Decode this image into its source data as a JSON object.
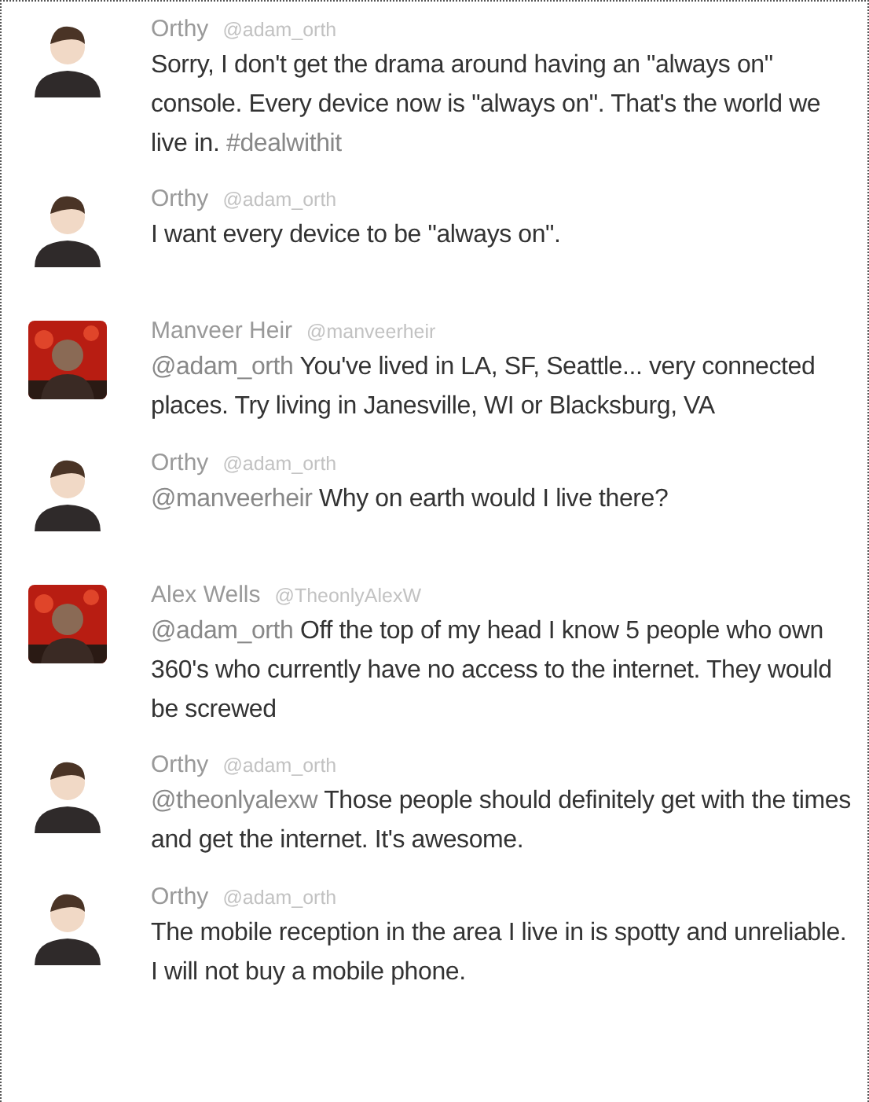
{
  "tweets": [
    {
      "name": "Orthy",
      "handle": "@adam_orth",
      "avatar": {
        "kind": "drawn"
      },
      "body": [
        {
          "kind": "text",
          "text": "Sorry, I don't get the drama around having an \"always on\" console. Every device now is \"always on\". That's the world we live in. "
        },
        {
          "kind": "link",
          "text": "#dealwithit"
        }
      ]
    },
    {
      "name": "Orthy",
      "handle": "@adam_orth",
      "avatar": {
        "kind": "drawn"
      },
      "body": [
        {
          "kind": "text",
          "text": "I want every device to be \"always on\"."
        }
      ]
    },
    {
      "name": "Manveer Heir",
      "handle": "@manveerheir",
      "body": [
        {
          "kind": "link",
          "text": "@adam_orth"
        },
        {
          "kind": "text",
          "text": " You've lived in LA, SF, Seattle... very connected places. Try living in Janesville, WI or Blacksburg, VA"
        }
      ]
    },
    {
      "name": "Orthy",
      "handle": "@adam_orth",
      "avatar": {
        "kind": "drawn"
      },
      "body": [
        {
          "kind": "link",
          "text": "@manveerheir"
        },
        {
          "kind": "text",
          "text": " Why on earth would I live there?"
        }
      ]
    },
    {
      "name": "Alex Wells",
      "handle": "@TheonlyAlexW",
      "body": [
        {
          "kind": "link",
          "text": "@adam_orth"
        },
        {
          "kind": "text",
          "text": " Off the top of my head I know 5 people who own 360's who currently have no access to the internet. They would be screwed"
        }
      ]
    },
    {
      "name": "Orthy",
      "handle": "@adam_orth",
      "avatar": {
        "kind": "drawn"
      },
      "body": [
        {
          "kind": "link",
          "text": "@theonlyalexw"
        },
        {
          "kind": "text",
          "text": " Those people should definitely get with the times and get the internet. It's awesome."
        }
      ]
    },
    {
      "name": "Orthy",
      "handle": "@adam_orth",
      "avatar": {
        "kind": "drawn"
      },
      "body": [
        {
          "kind": "text",
          "text": "The mobile reception in the area I live in is spotty and unreliable. I will not buy a mobile phone."
        }
      ]
    }
  ]
}
